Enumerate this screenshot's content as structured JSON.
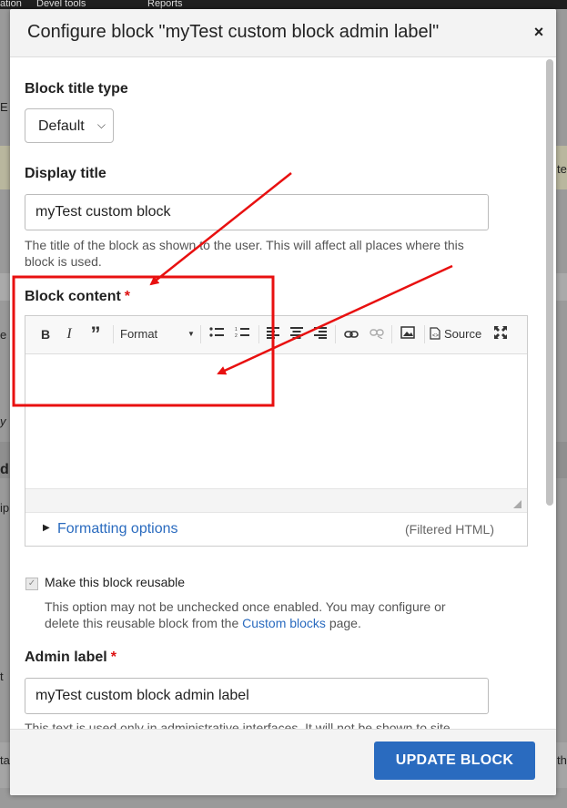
{
  "background": {
    "toolbar_items": [
      "ation",
      "Devel tools",
      "Reports"
    ],
    "fragments": [
      "E",
      "tes",
      "e h",
      "y",
      "d",
      "ip",
      "t",
      "ta",
      "th"
    ]
  },
  "dialog": {
    "title": "Configure block \"myTest custom block admin label\"",
    "close_icon": "close-icon",
    "block_title_type": {
      "label": "Block title type",
      "value": "Default"
    },
    "display_title": {
      "label": "Display title",
      "value": "myTest custom block",
      "description_line1": "The title of the block as shown to the user. This will affect all places where this",
      "description_line2": "block is used."
    },
    "block_content": {
      "label": "Block content",
      "required_mark": "*",
      "toolbar": {
        "bold": "B",
        "italic": "I",
        "quote": "”",
        "format": "Format",
        "source": "Source"
      },
      "formatting_options": "Formatting options",
      "filter_label": "(Filtered HTML)"
    },
    "reusable": {
      "label": "Make this block reusable",
      "checked": true,
      "description_line1": "This option may not be unchecked once enabled. You may configure or",
      "description_line2_pre": "delete this reusable block from the ",
      "description_link": "Custom blocks",
      "description_line2_post": " page."
    },
    "admin_label": {
      "label": "Admin label",
      "required_mark": "*",
      "value": "myTest custom block admin label",
      "description": "This text is used only in administrative interfaces. It will not be shown to site"
    },
    "update_button": "UPDATE BLOCK"
  },
  "colors": {
    "accent": "#2a6bbf",
    "required": "#dd1111",
    "annotation": "#e81010"
  }
}
